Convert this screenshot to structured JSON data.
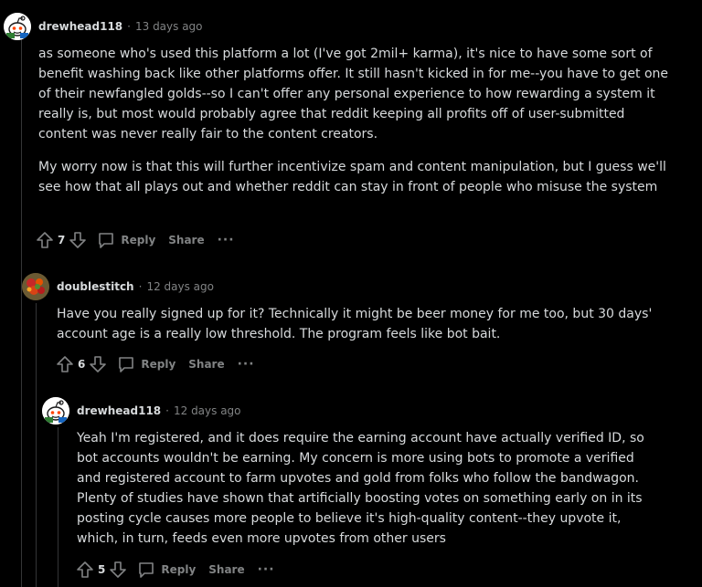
{
  "comments": [
    {
      "username": "drewhead118",
      "separator": "·",
      "time": "13 days ago",
      "avatar_icon": "snoo-avatar-icon",
      "paragraphs": [
        "as someone who's used this platform a lot (I've got 2mil+ karma), it's nice to have some sort of benefit washing back like other platforms offer. It still hasn't kicked in for me--you have to get one of their newfangled golds--so I can't offer any personal experience to how rewarding a system it really is, but most would probably agree that reddit keeping all profits off of user-submitted content was never really fair to the content creators.",
        "My worry now is that this will further incentivize spam and content manipulation, but I guess we'll see how that all plays out and whether reddit can stay in front of people who misuse the system"
      ],
      "votes": "7",
      "reply_label": "Reply",
      "share_label": "Share",
      "more_label": "···"
    },
    {
      "username": "doublestitch",
      "separator": "·",
      "time": "12 days ago",
      "avatar_icon": "food-photo-avatar-icon",
      "paragraphs": [
        "Have you really signed up for it? Technically it might be beer money for me too, but 30 days' account age is a really low threshold. The program feels like bot bait."
      ],
      "votes": "6",
      "reply_label": "Reply",
      "share_label": "Share",
      "more_label": "···"
    },
    {
      "username": "drewhead118",
      "separator": "·",
      "time": "12 days ago",
      "avatar_icon": "snoo-avatar-icon",
      "paragraphs": [
        "Yeah I'm registered, and it does require the earning account have actually verified ID, so bot accounts wouldn't be earning. My concern is more using bots to promote a verified and registered account to farm upvotes and gold from folks who follow the bandwagon. Plenty of studies have shown that artificially boosting votes on something early on in its posting cycle causes more people to believe it's high-quality content--they upvote it, which, in turn, feeds even more upvotes from other users"
      ],
      "votes": "5",
      "reply_label": "Reply",
      "share_label": "Share",
      "more_label": "···"
    }
  ],
  "colors": {
    "background": "#000000",
    "text": "#d7dadc",
    "muted": "#818384",
    "thread_line": "#343536"
  }
}
